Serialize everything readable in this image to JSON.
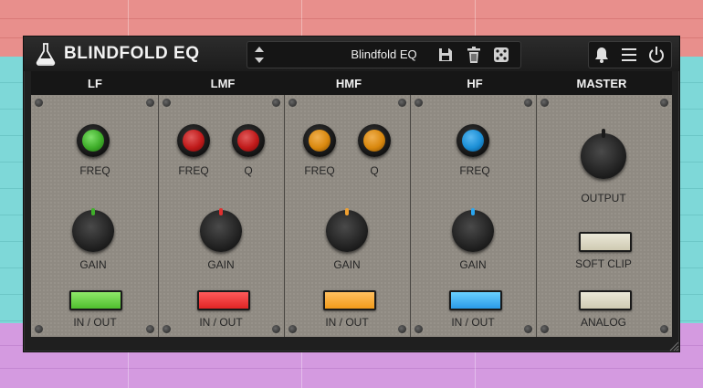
{
  "plugin": {
    "name": "BLINDFOLD EQ",
    "preset": "Blindfold EQ"
  },
  "bands": [
    {
      "id": "lf",
      "title": "LF",
      "color": "#3fae2a",
      "freq_label": "FREQ",
      "gain_label": "GAIN",
      "switch_label": "IN / OUT"
    },
    {
      "id": "lmf",
      "title": "LMF",
      "color": "#c01a1a",
      "freq_label": "FREQ",
      "q_label": "Q",
      "gain_label": "GAIN",
      "switch_label": "IN / OUT"
    },
    {
      "id": "hmf",
      "title": "HMF",
      "color": "#d9880e",
      "freq_label": "FREQ",
      "q_label": "Q",
      "gain_label": "GAIN",
      "switch_label": "IN / OUT"
    },
    {
      "id": "hf",
      "title": "HF",
      "color": "#1b8fd6",
      "freq_label": "FREQ",
      "gain_label": "GAIN",
      "switch_label": "IN / OUT"
    }
  ],
  "master": {
    "title": "MASTER",
    "output_label": "OUTPUT",
    "soft_clip_label": "SOFT CLIP",
    "analog_label": "ANALOG"
  },
  "icons": [
    "flask-icon",
    "preset-arrows-icon",
    "save-icon",
    "trash-icon",
    "dice-icon",
    "bell-icon",
    "menu-icon",
    "power-icon"
  ],
  "colors": {
    "switch_cream": "#ddd9c4",
    "panel": "#8f8a82",
    "lf": "#3fae2a",
    "lmf": "#c01a1a",
    "hmf": "#d9880e",
    "hf": "#1b8fd6"
  }
}
